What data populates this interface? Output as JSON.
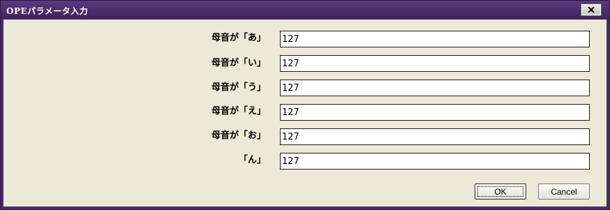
{
  "window": {
    "title": "OPEパラメータ入力",
    "close_icon": "close-icon"
  },
  "form": {
    "fields": [
      {
        "label": "母音が「あ」",
        "value": "127"
      },
      {
        "label": "母音が「い」",
        "value": "127"
      },
      {
        "label": "母音が「う」",
        "value": "127"
      },
      {
        "label": "母音が「え」",
        "value": "127"
      },
      {
        "label": "母音が「お」",
        "value": "127"
      },
      {
        "label": "「ん」",
        "value": "127"
      }
    ]
  },
  "buttons": {
    "ok_label": "OK",
    "cancel_label": "Cancel"
  }
}
